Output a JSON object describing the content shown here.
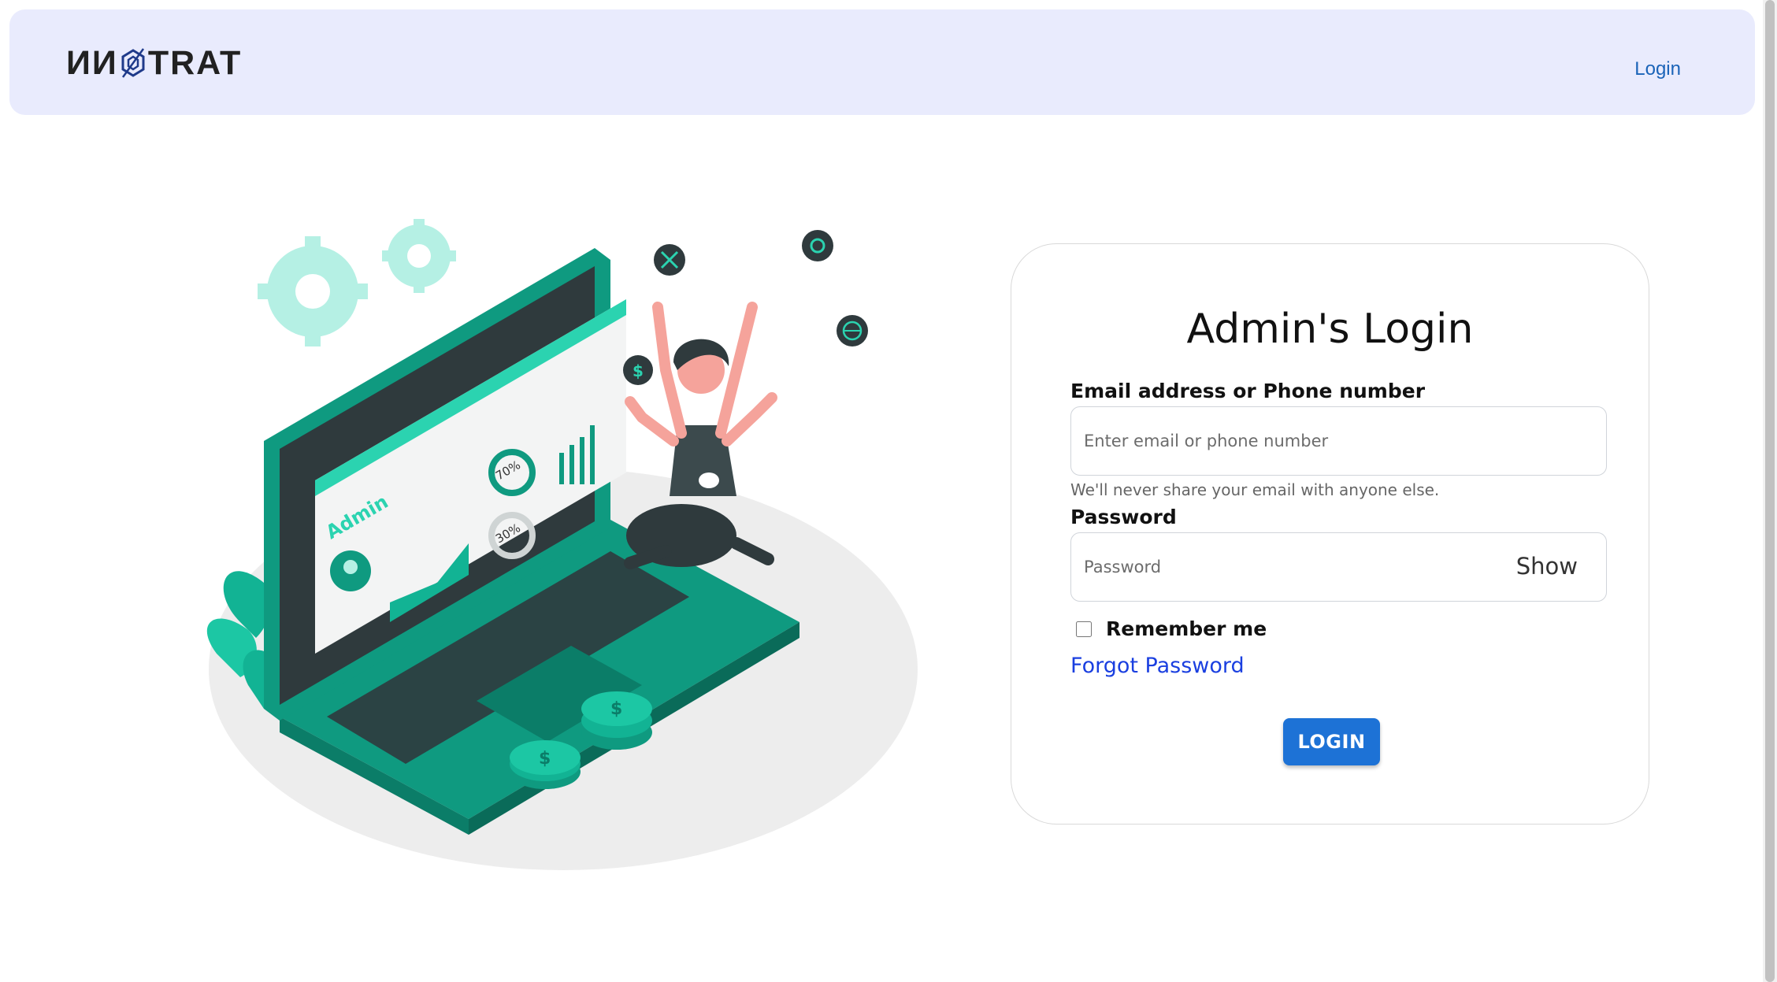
{
  "navbar": {
    "brand_prefix": "ИИ",
    "brand_suffix": "TRAT",
    "login_link": "Login"
  },
  "illustration": {
    "screen_label": "Admin",
    "gauge_top": "70%",
    "gauge_bottom": "30%",
    "icon_names": [
      "gear-icon",
      "tools-icon",
      "dollar-icon",
      "globe-icon"
    ]
  },
  "login_card": {
    "title": "Admin's Login",
    "email_label": "Email address or Phone number",
    "email_placeholder": "Enter email or phone number",
    "email_help": "We'll never share your email with anyone else.",
    "password_label": "Password",
    "password_placeholder": "Password",
    "show_label": "Show",
    "remember_label": "Remember me",
    "forgot_label": "Forgot Password",
    "submit_label": "LOGIN"
  },
  "colors": {
    "navbar_bg": "#e9ebfd",
    "primary": "#1d72d6",
    "link": "#1a3fe0",
    "teal": "#0f9a80"
  }
}
